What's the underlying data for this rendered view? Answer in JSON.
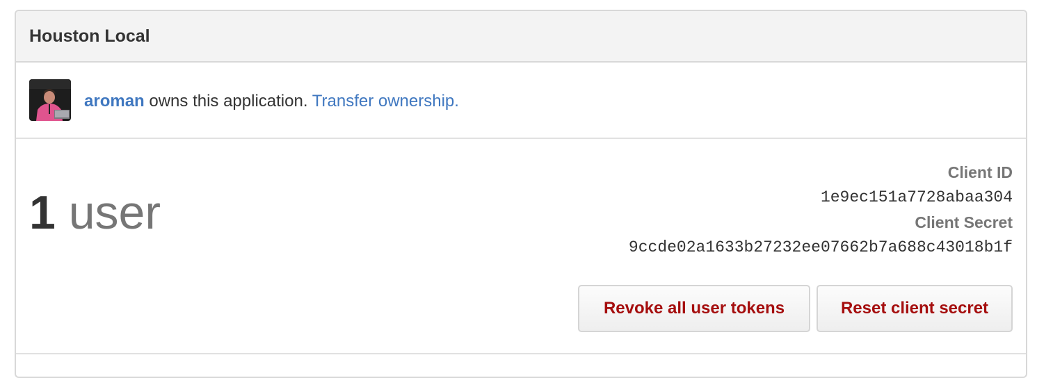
{
  "app": {
    "title": "Houston Local"
  },
  "owner": {
    "username": "aroman",
    "owns_text": " owns this application. ",
    "transfer_label": "Transfer ownership."
  },
  "stats": {
    "user_count": "1",
    "user_unit": "user"
  },
  "credentials": {
    "client_id_label": "Client ID",
    "client_id": "1e9ec151a7728abaa304",
    "client_secret_label": "Client Secret",
    "client_secret": "9ccde02a1633b27232ee07662b7a688c43018b1f"
  },
  "actions": {
    "revoke_label": "Revoke all user tokens",
    "reset_label": "Reset client secret"
  },
  "colors": {
    "link": "#4078c0",
    "danger_text": "#a50e0e",
    "header_bg": "#f3f3f3",
    "border": "#d8d8d8",
    "muted": "#767676"
  }
}
